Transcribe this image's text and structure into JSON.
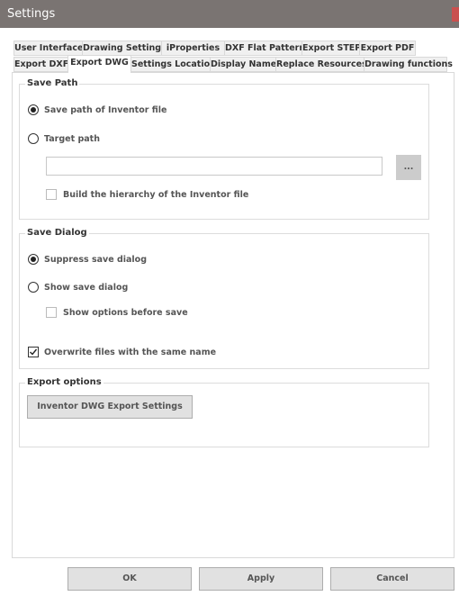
{
  "window": {
    "title": "Settings"
  },
  "tabs_row1": [
    "User Interface",
    "Drawing Settings",
    "iProperties",
    "DXF Flat Pattern",
    "Export STEP",
    "Export PDF"
  ],
  "tabs_row2": [
    "Export DXF",
    "Export DWG",
    "Settings Location",
    "Display Name",
    "Replace Resources",
    "Drawing functions"
  ],
  "active_tab": "Export DWG",
  "save_path": {
    "title": "Save Path",
    "option_inventor": "Save path of Inventor file",
    "option_target": "Target path",
    "selected": "Save path of Inventor file",
    "target_path_value": "",
    "browse_label": "...",
    "build_hierarchy": "Build the hierarchy of the Inventor file",
    "build_hierarchy_checked": false
  },
  "save_dialog": {
    "title": "Save Dialog",
    "option_suppress": "Suppress save dialog",
    "option_show": "Show save dialog",
    "selected": "Suppress save dialog",
    "show_options": "Show options before save",
    "show_options_checked": false,
    "overwrite": "Overwrite files with the same name",
    "overwrite_checked": true
  },
  "export_options": {
    "title": "Export options",
    "settings_button": "Inventor DWG Export Settings"
  },
  "footer": {
    "ok": "OK",
    "apply": "Apply",
    "cancel": "Cancel"
  }
}
